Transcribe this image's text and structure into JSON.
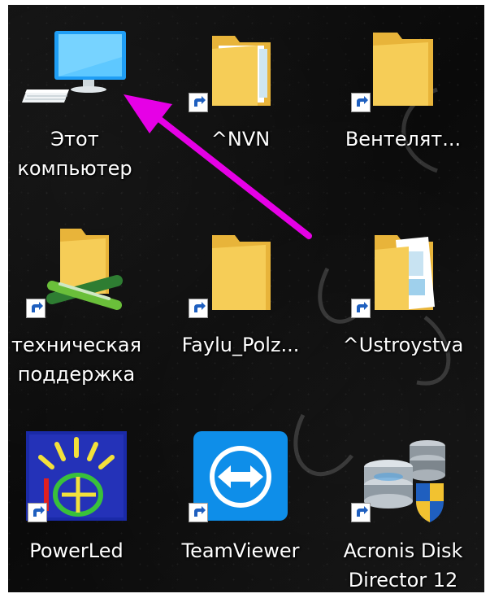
{
  "desktop": {
    "icons": [
      {
        "label": "Этот",
        "label2": "компьютер",
        "icon": "monitor-icon",
        "shortcut": false
      },
      {
        "label": "^NVN",
        "label2": "",
        "icon": "folder-icon",
        "shortcut": true
      },
      {
        "label": "Вентелят...",
        "label2": "",
        "icon": "folder-icon",
        "shortcut": true
      },
      {
        "label": "техническая",
        "label2": "поддержка",
        "icon": "folder-network-icon",
        "shortcut": true
      },
      {
        "label": "Faylu_Polz...",
        "label2": "",
        "icon": "folder-icon",
        "shortcut": true
      },
      {
        "label": "^Ustroystva",
        "label2": "",
        "icon": "folder-document-icon",
        "shortcut": true
      },
      {
        "label": "PowerLed",
        "label2": "",
        "icon": "powerled-app-icon",
        "shortcut": true
      },
      {
        "label": "TeamViewer",
        "label2": "",
        "icon": "teamviewer-icon",
        "shortcut": true
      },
      {
        "label": "Acronis Disk",
        "label2": "Director 12",
        "icon": "acronis-disk-director-icon",
        "shortcut": true
      }
    ]
  },
  "colors": {
    "annotation_arrow": "#e600e6",
    "folder": "#f3c54a",
    "label_text": "#ffffff"
  }
}
